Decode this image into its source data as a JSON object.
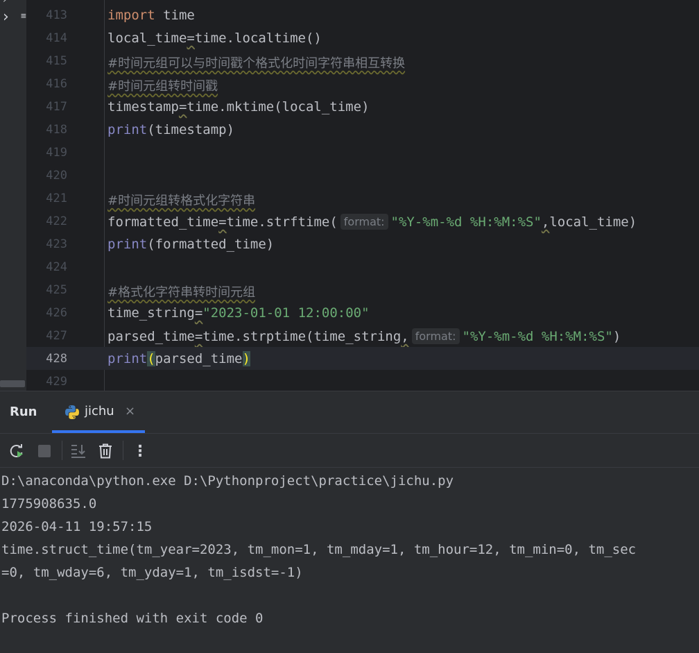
{
  "editor": {
    "lines": [
      {
        "num": "413"
      },
      {
        "num": "414"
      },
      {
        "num": "415"
      },
      {
        "num": "416"
      },
      {
        "num": "417"
      },
      {
        "num": "418"
      },
      {
        "num": "419"
      },
      {
        "num": "420"
      },
      {
        "num": "421"
      },
      {
        "num": "422"
      },
      {
        "num": "423"
      },
      {
        "num": "424"
      },
      {
        "num": "425"
      },
      {
        "num": "426"
      },
      {
        "num": "427"
      },
      {
        "num": "428"
      },
      {
        "num": "429"
      }
    ],
    "tokens": {
      "l413_kw": "import",
      "l413_rest": " time",
      "l414_a": "local_time",
      "l414_b": "=",
      "l414_c": "time.localtime()",
      "l415": "#时间元组可以与时间戳个格式化时间字符串相互转换",
      "l416": "#时间元组转时间戳",
      "l417_a": "timestamp",
      "l417_b": "=",
      "l417_c": "time.mktime(local_time)",
      "l418_fn": "print",
      "l418_rest": "(timestamp)",
      "l421": "#时间元组转格式化字符串",
      "l422_a": "formatted_time",
      "l422_b": "=",
      "l422_c": "time.strftime(",
      "l422_hint": "format:",
      "l422_str": "\"%Y-%m-%d %H:%M:%S\"",
      "l422_comma": ",",
      "l422_rest": "local_time)",
      "l423_fn": "print",
      "l423_rest": "(formatted_time)",
      "l425": "#格式化字符串转时间元组",
      "l426_a": "time_string",
      "l426_b": "=",
      "l426_str": "\"2023-01-01 12:00:00\"",
      "l427_a": "parsed_time",
      "l427_b": "=",
      "l427_c": "time.strptime(time_string",
      "l427_comma": ",",
      "l427_hint": "format:",
      "l427_str": "\"%Y-%m-%d %H:%M:%S\"",
      "l427_close": ")",
      "l428_fn": "print",
      "l428_open": "(",
      "l428_mid": "parsed_time",
      "l428_close": ")"
    }
  },
  "run_panel": {
    "title": "Run",
    "tab_label": "jichu",
    "tab_close": "×",
    "toolbar": {
      "more": "⋮"
    },
    "output": [
      "D:\\anaconda\\python.exe D:\\Pythonproject\\practice\\jichu.py",
      "1775908635.0",
      "2026-04-11 19:57:15",
      "time.struct_time(tm_year=2023, tm_mon=1, tm_mday=1, tm_hour=12, tm_min=0, tm_sec",
      "=0, tm_wday=6, tm_yday=1, tm_isdst=-1)",
      "",
      "Process finished with exit code 0"
    ]
  },
  "colors": {
    "keyword": "#cf8e6d",
    "builtin": "#8888c6",
    "string": "#6aab73",
    "comment": "#7a7e85",
    "tab_underline": "#3574f0"
  },
  "icons": [
    "chevron-right-icon",
    "structure-icon",
    "python-icon",
    "close-icon",
    "rerun-icon",
    "stop-icon",
    "scroll-to-end-icon",
    "trash-icon",
    "more-vertical-icon"
  ]
}
